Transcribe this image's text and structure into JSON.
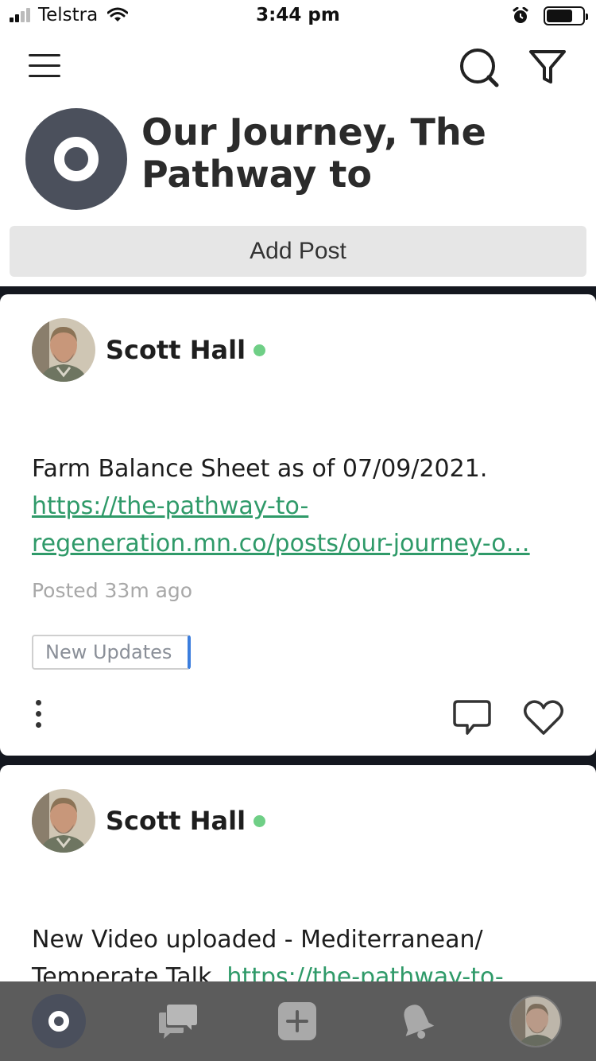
{
  "status_bar": {
    "carrier": "Telstra",
    "time": "3:44 pm"
  },
  "nav": {
    "menu_icon": "hamburger-icon",
    "search_icon": "search-icon",
    "filter_icon": "filter-icon"
  },
  "group": {
    "title": "Our Journey, The Pathway to",
    "avatar_color": "#4b505c"
  },
  "add_post_label": "Add Post",
  "posts": [
    {
      "author": "Scott Hall",
      "online": true,
      "text": "Farm Balance Sheet as of 07/09/2021.",
      "link_line1": "https://the-pathway-to-",
      "link_line2": "regeneration.mn.co/posts/our-journey-o…",
      "posted": "Posted 33m ago",
      "badge": "New Updates"
    },
    {
      "author": "Scott Hall",
      "online": true,
      "text_line1": "New Video uploaded - Mediterranean/",
      "text_line2": "Temperate Talk.",
      "link": "https://the-pathway-to-"
    }
  ],
  "tab_bar": {
    "tabs": [
      "home-icon",
      "chat-icon",
      "add-icon",
      "bell-icon",
      "profile-avatar"
    ]
  },
  "colors": {
    "link": "#2f9a69",
    "online": "#6fcf86",
    "badge_accent": "#3b7ddd",
    "feed_background": "#14171f",
    "tab_bar": "#5c5c5c"
  }
}
